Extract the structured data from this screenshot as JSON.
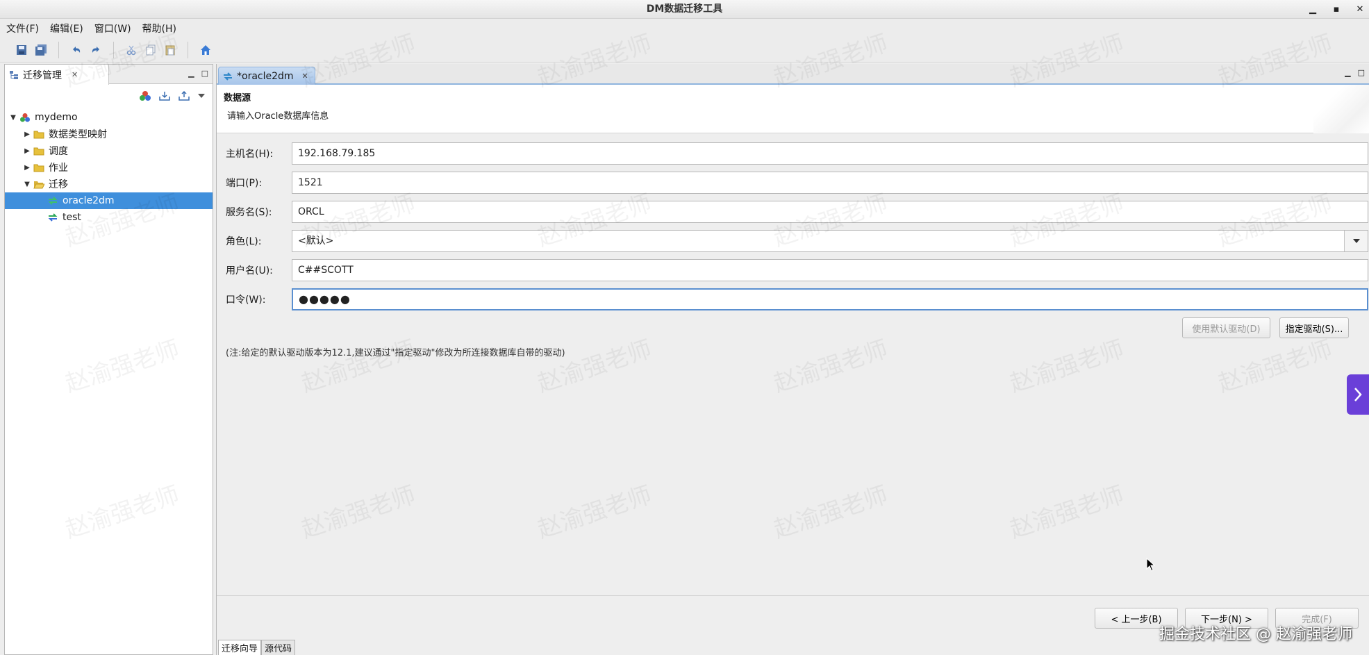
{
  "window": {
    "title": "DM数据迁移工具"
  },
  "menu": [
    "文件(F)",
    "编辑(E)",
    "窗口(W)",
    "帮助(H)"
  ],
  "left_panel": {
    "tab_label": "迁移管理",
    "tree": [
      {
        "label": "mydemo",
        "level": 0,
        "expanded": true,
        "icon": "project-icon"
      },
      {
        "label": "数据类型映射",
        "level": 1,
        "expanded": false,
        "icon": "folder-icon"
      },
      {
        "label": "调度",
        "level": 1,
        "expanded": false,
        "icon": "folder-icon"
      },
      {
        "label": "作业",
        "level": 1,
        "expanded": false,
        "icon": "folder-icon"
      },
      {
        "label": "迁移",
        "level": 1,
        "expanded": true,
        "icon": "folder-open-icon"
      },
      {
        "label": "oracle2dm",
        "level": 2,
        "selected": true,
        "icon": "migration-icon"
      },
      {
        "label": "test",
        "level": 2,
        "icon": "migration-icon"
      }
    ]
  },
  "editor": {
    "tab_label": "*oracle2dm",
    "section_title": "数据源",
    "section_desc": "请输入Oracle数据库信息",
    "fields": {
      "host": {
        "label": "主机名(H):",
        "value": "192.168.79.185"
      },
      "port": {
        "label": "端口(P):",
        "value": "1521"
      },
      "service": {
        "label": "服务名(S):",
        "value": "ORCL"
      },
      "role": {
        "label": "角色(L):",
        "value": "<默认>"
      },
      "user": {
        "label": "用户名(U):",
        "value": "C##SCOTT"
      },
      "password": {
        "label": "口令(W):",
        "value": "●●●●●"
      }
    },
    "default_driver_btn": "使用默认驱动(D)",
    "specify_driver_btn": "指定驱动(S)...",
    "note": "(注:给定的默认驱动版本为12.1,建议通过\"指定驱动\"修改为所连接数据库自带的驱动)",
    "prev_btn": "< 上一步(B)",
    "next_btn": "下一步(N) >",
    "finish_btn": "完成(F)",
    "bottom_tabs": [
      "迁移向导",
      "源代码"
    ]
  },
  "watermark_text": "赵渝强老师",
  "footer_watermark": "掘金技术社区 @ 赵渝强老师",
  "colors": {
    "selection": "#3f8fdc",
    "accent": "#6a3fd8"
  }
}
